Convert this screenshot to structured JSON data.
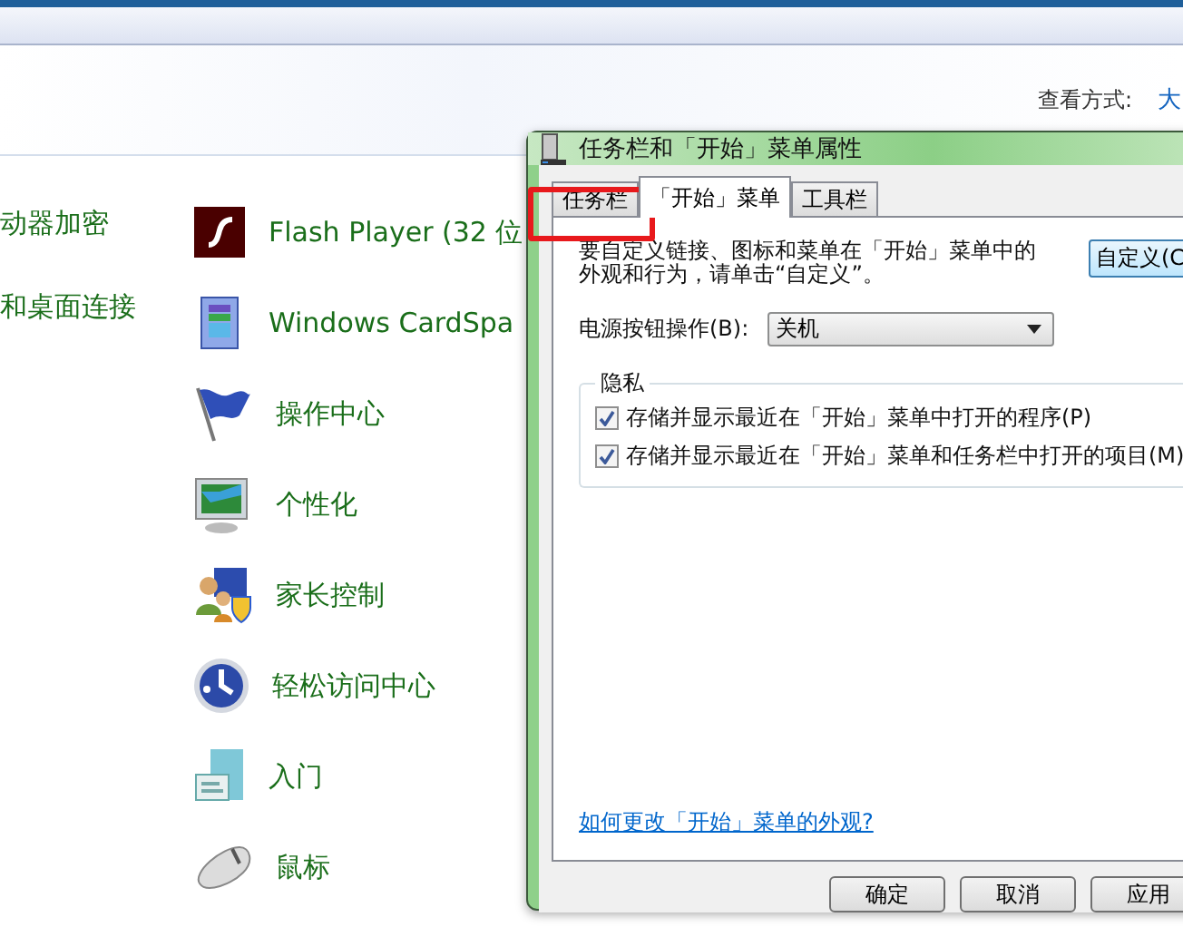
{
  "header": {
    "view_label": "查看方式:",
    "view_value": "大"
  },
  "items_left": [
    {
      "label": "动器加密"
    },
    {
      "label": "和桌面连接"
    }
  ],
  "items": [
    {
      "label": "Flash Player (32 位",
      "kind": "flash"
    },
    {
      "label": "Windows CardSpa",
      "kind": "card"
    },
    {
      "label": "操作中心",
      "kind": "flag"
    },
    {
      "label": "个性化",
      "kind": "monitor"
    },
    {
      "label": "家长控制",
      "kind": "parental"
    },
    {
      "label": "轻松访问中心",
      "kind": "dial"
    },
    {
      "label": "入门",
      "kind": "document"
    },
    {
      "label": "鼠标",
      "kind": "mouse"
    }
  ],
  "dialog": {
    "title": "任务栏和「开始」菜单属性",
    "tabs": [
      {
        "label": "任务栏",
        "selected": false
      },
      {
        "label": "「开始」菜单",
        "selected": true
      },
      {
        "label": "工具栏",
        "selected": false
      }
    ],
    "description": "要自定义链接、图标和菜单在「开始」菜单中的外观和行为，请单击“自定义”。",
    "customize_button": "自定义(C",
    "power": {
      "label": "电源按钮操作(B):",
      "value": "关机"
    },
    "privacy": {
      "title": "隐私",
      "options": [
        {
          "label": "存储并显示最近在「开始」菜单中打开的程序(P)",
          "checked": true
        },
        {
          "label": "存储并显示最近在「开始」菜单和任务栏中打开的项目(M)",
          "checked": true
        }
      ]
    },
    "help_link": "如何更改「开始」菜单的外观?",
    "buttons": [
      "确定",
      "取消",
      "应用"
    ]
  }
}
